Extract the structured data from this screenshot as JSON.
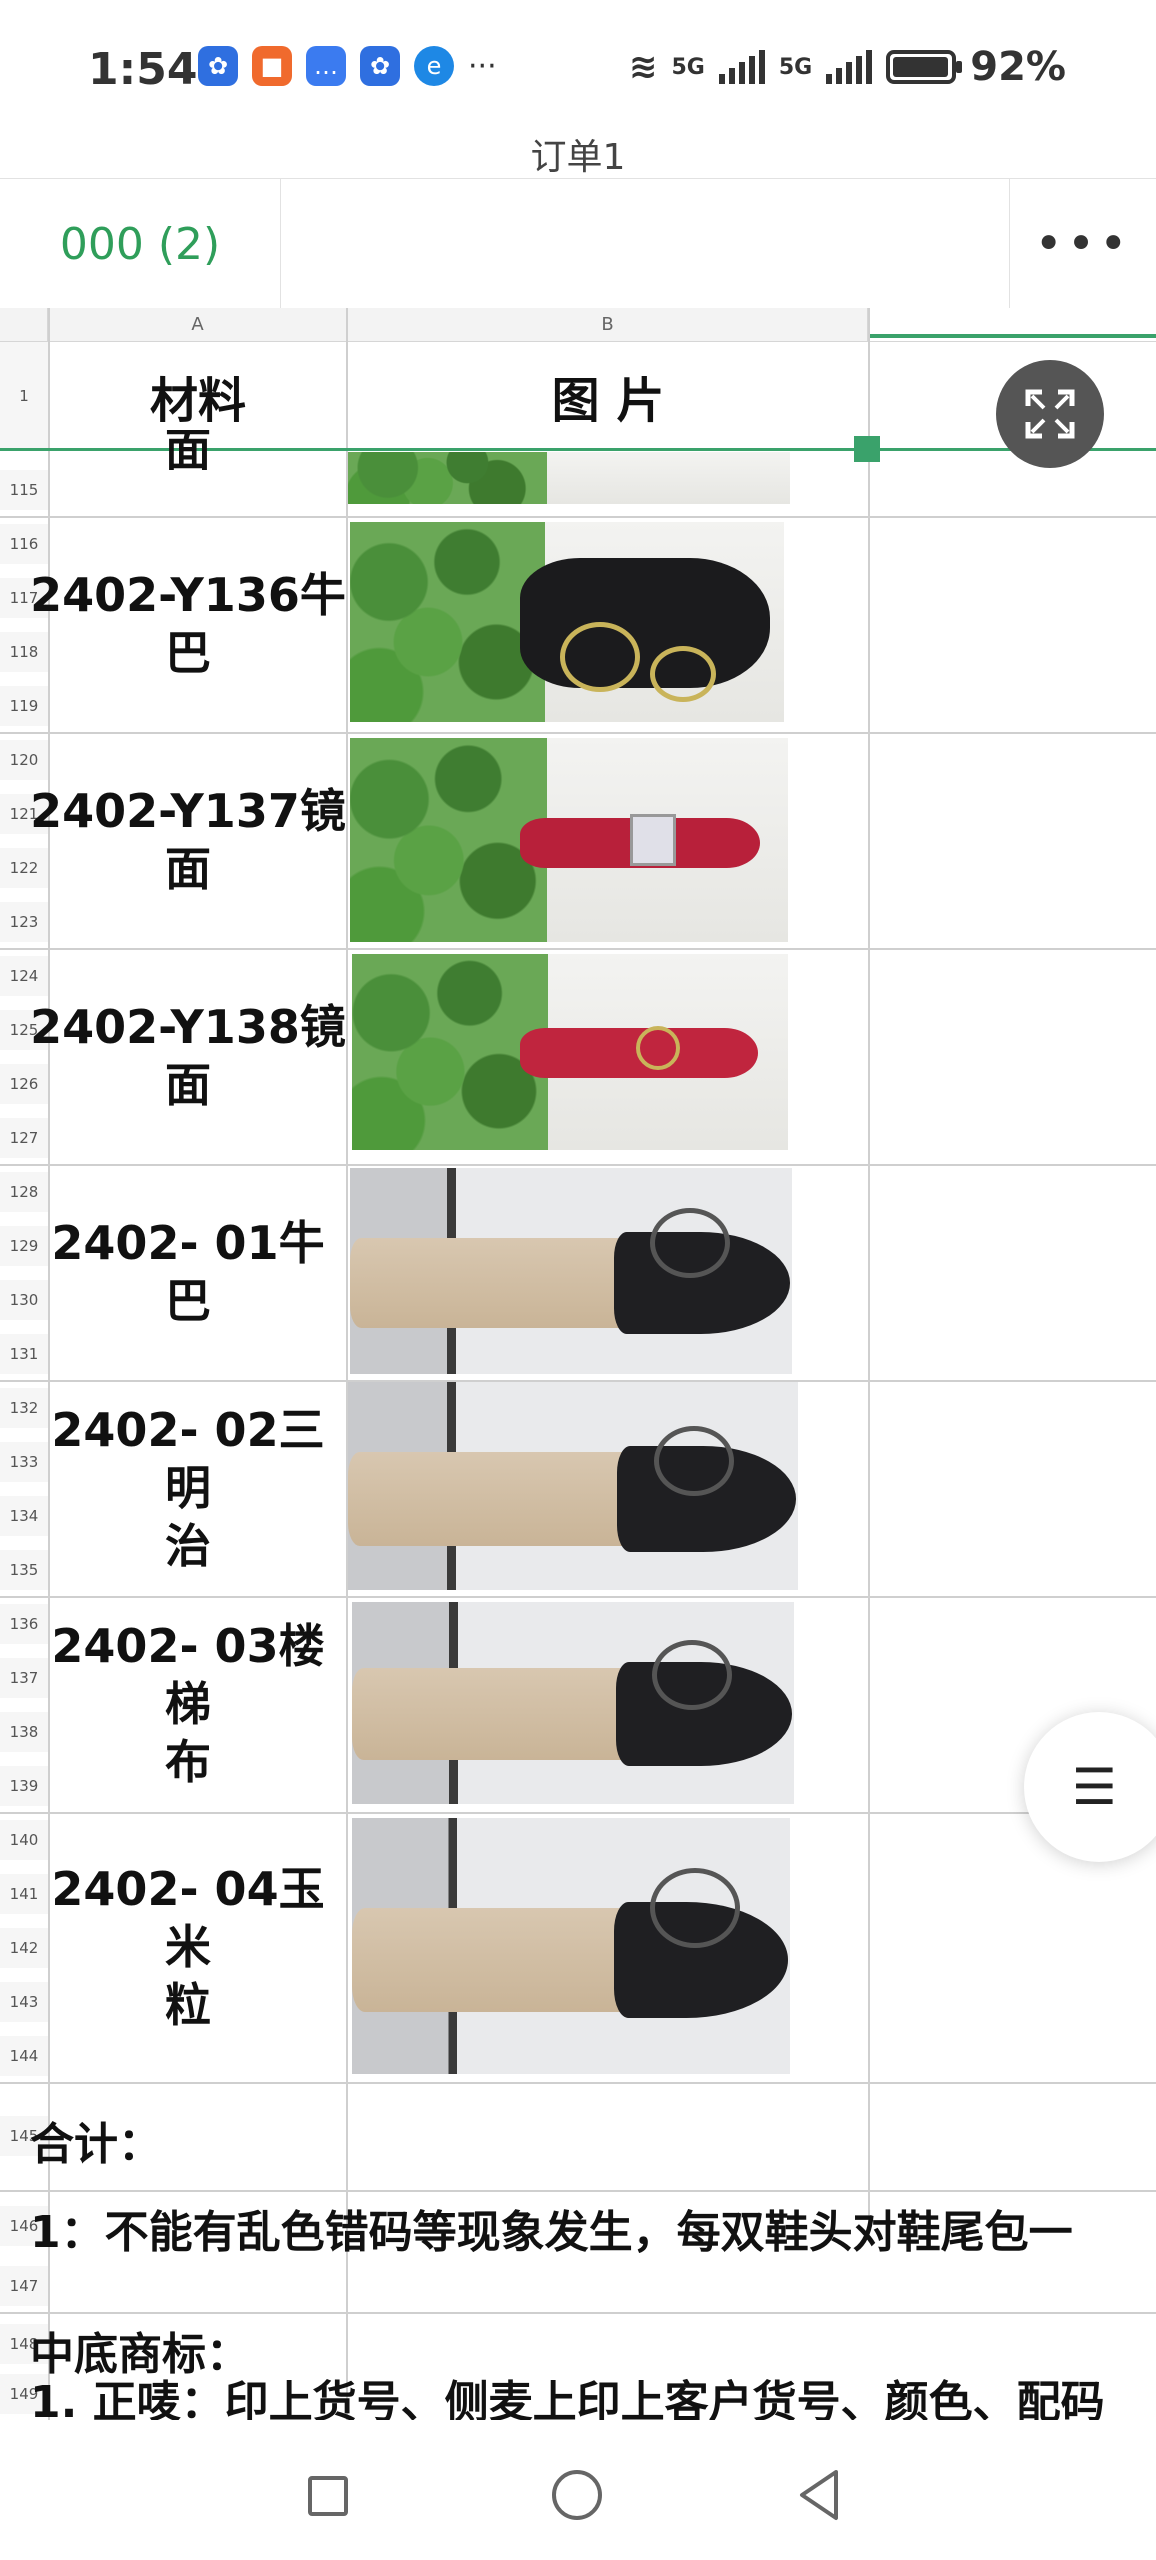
{
  "status": {
    "time": "1:54",
    "battery": "92%",
    "net1": "5G",
    "net2": "5G"
  },
  "doc": {
    "title": "订单1"
  },
  "sheet_tab": {
    "label": "000 (2)"
  },
  "toolbar": {
    "more": "•••"
  },
  "columns": [
    "A",
    "B"
  ],
  "header": {
    "material": "材料",
    "image": "图 片"
  },
  "row_numbers": {
    "r1": "1",
    "r115": "115",
    "r116": "116",
    "r117": "117",
    "r118": "118",
    "r119": "119",
    "r120": "120",
    "r121": "121",
    "r122": "122",
    "r123": "123",
    "r124": "124",
    "r125": "125",
    "r126": "126",
    "r127": "127",
    "r128": "128",
    "r129": "129",
    "r130": "130",
    "r131": "131",
    "r132": "132",
    "r133": "133",
    "r134": "134",
    "r135": "135",
    "r136": "136",
    "r137": "137",
    "r138": "138",
    "r139": "139",
    "r140": "140",
    "r141": "141",
    "r142": "142",
    "r143": "143",
    "r144": "144",
    "r145": "145",
    "r146": "146",
    "r147": "147",
    "r148": "148",
    "r149": "149"
  },
  "rows": [
    {
      "l1": "2402-Y136牛",
      "l2": "巴"
    },
    {
      "l1": "2402-Y137镜",
      "l2": "面"
    },
    {
      "l1": "2402-Y138镜",
      "l2": "面"
    },
    {
      "l1": "2402- 01牛巴",
      "l2": ""
    },
    {
      "l1": "2402- 02三明",
      "l2": "治"
    },
    {
      "l1": "2402- 03楼梯",
      "l2": "布"
    },
    {
      "l1": "2402- 04玉米",
      "l2": "粒"
    }
  ],
  "partial_top": "面",
  "notes": {
    "total": "合计：",
    "requirement": "1：不能有乱色错码等现象发生，每双鞋头对鞋尾包一",
    "sole_label": "中底商标：",
    "front": "1. 正唛：印上货号、侧麦上印上客户货号、颜色、配码"
  },
  "menu_fab": {
    "label": "☰"
  },
  "colors": {
    "accent": "#3aa26b",
    "tab_text": "#2f9e5a"
  }
}
